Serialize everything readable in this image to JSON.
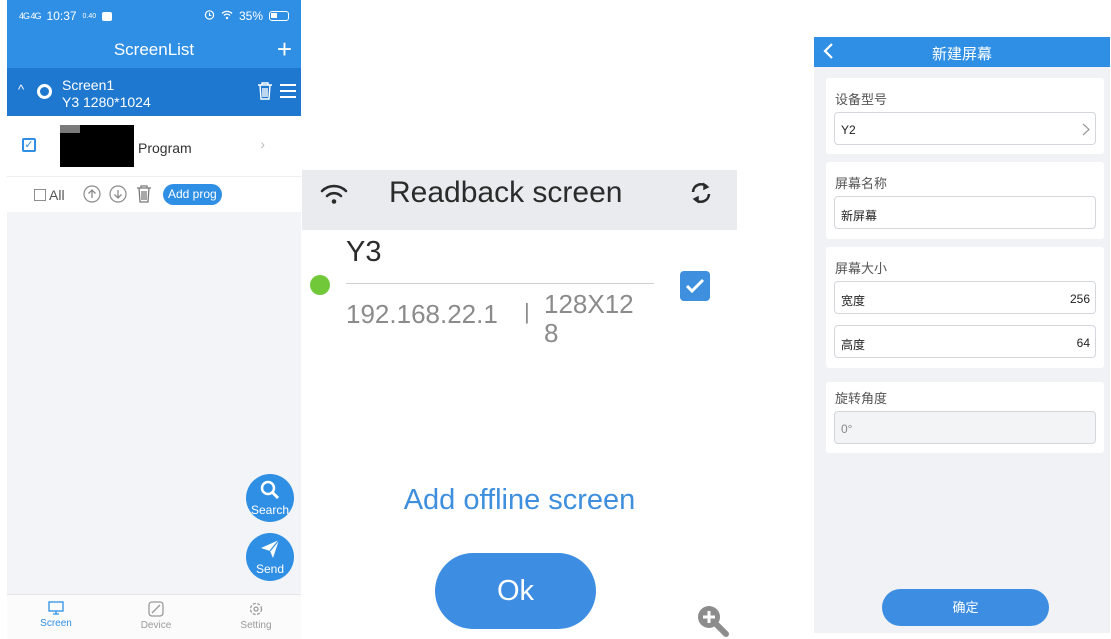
{
  "screen_list": {
    "status": {
      "signal": "4G 4G",
      "time": "10:37",
      "net_speed": "0.40",
      "battery": "35%"
    },
    "title": "ScreenList",
    "add_symbol": "+",
    "screen": {
      "name": "Screen1",
      "spec": "Y3  1280*1024"
    },
    "program": {
      "label": "Program"
    },
    "toolbar": {
      "all_label": "All",
      "add_program_label": "Add prog"
    },
    "fab": {
      "search_label": "Search",
      "send_label": "Send"
    },
    "tabs": [
      {
        "label": "Screen"
      },
      {
        "label": "Device"
      },
      {
        "label": "Setting"
      }
    ],
    "colors": {
      "primary": "#2f8fe4",
      "row": "#1e78cf"
    }
  },
  "readback": {
    "title": "Readback screen",
    "device": {
      "name": "Y3",
      "ip": "192.168.22.1",
      "separator": "|",
      "resolution": "128X128",
      "status_color": "#71c93a"
    },
    "add_offline_label": "Add offline screen",
    "ok_label": "Ok"
  },
  "new_screen": {
    "title": "新建屏幕",
    "device_model": {
      "label": "设备型号",
      "value": "Y2"
    },
    "screen_name": {
      "label": "屏幕名称",
      "value": "新屏幕"
    },
    "screen_size": {
      "label": "屏幕大小",
      "width_label": "宽度",
      "width_value": "256",
      "height_label": "高度",
      "height_value": "64"
    },
    "rotation": {
      "label": "旋转角度",
      "placeholder": "0°"
    },
    "confirm_label": "确定"
  }
}
